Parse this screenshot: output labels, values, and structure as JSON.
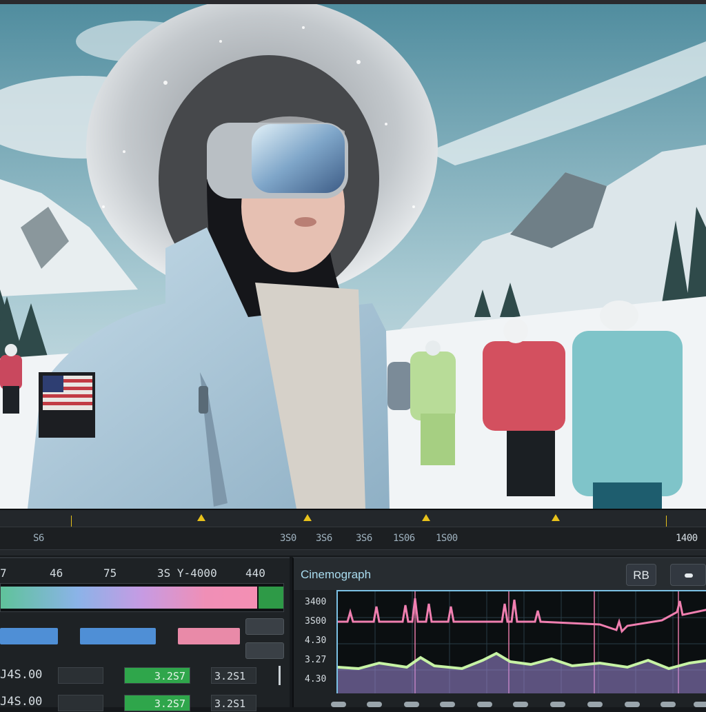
{
  "preview": {
    "image": "winter-ski-scene",
    "colors": {
      "sky": "#7fb0c0",
      "snow": "#eef2f4",
      "jacket": "#a9c8dc",
      "fur": "#d3d6d8"
    }
  },
  "timeline": {
    "labels": [
      "S6",
      "3S0",
      "3S6",
      "3S6",
      "1S06",
      "1S00",
      "1400"
    ]
  },
  "left_panel": {
    "header_numbers": [
      "7",
      "46",
      "75",
      "3S Y-4000",
      "440"
    ],
    "chip_buttons": [
      "",
      ""
    ],
    "value_rows": [
      {
        "label": "J4S.00",
        "box": "",
        "green": "3.2S7",
        "value": "3.2S1"
      },
      {
        "label": "J4S.00",
        "box": "",
        "green": "3.2S7",
        "value": "3.2S1"
      }
    ]
  },
  "right_panel": {
    "title": "Cinemograph",
    "rb_label": "RB",
    "y_labels": [
      "3400",
      "3S00",
      "4.30",
      "3.27",
      "4.30"
    ],
    "colors": {
      "accent": "#7cc2e6",
      "pink": "#f07fb0",
      "green": "#c7f3a5",
      "purple": "#a08ad8"
    }
  }
}
